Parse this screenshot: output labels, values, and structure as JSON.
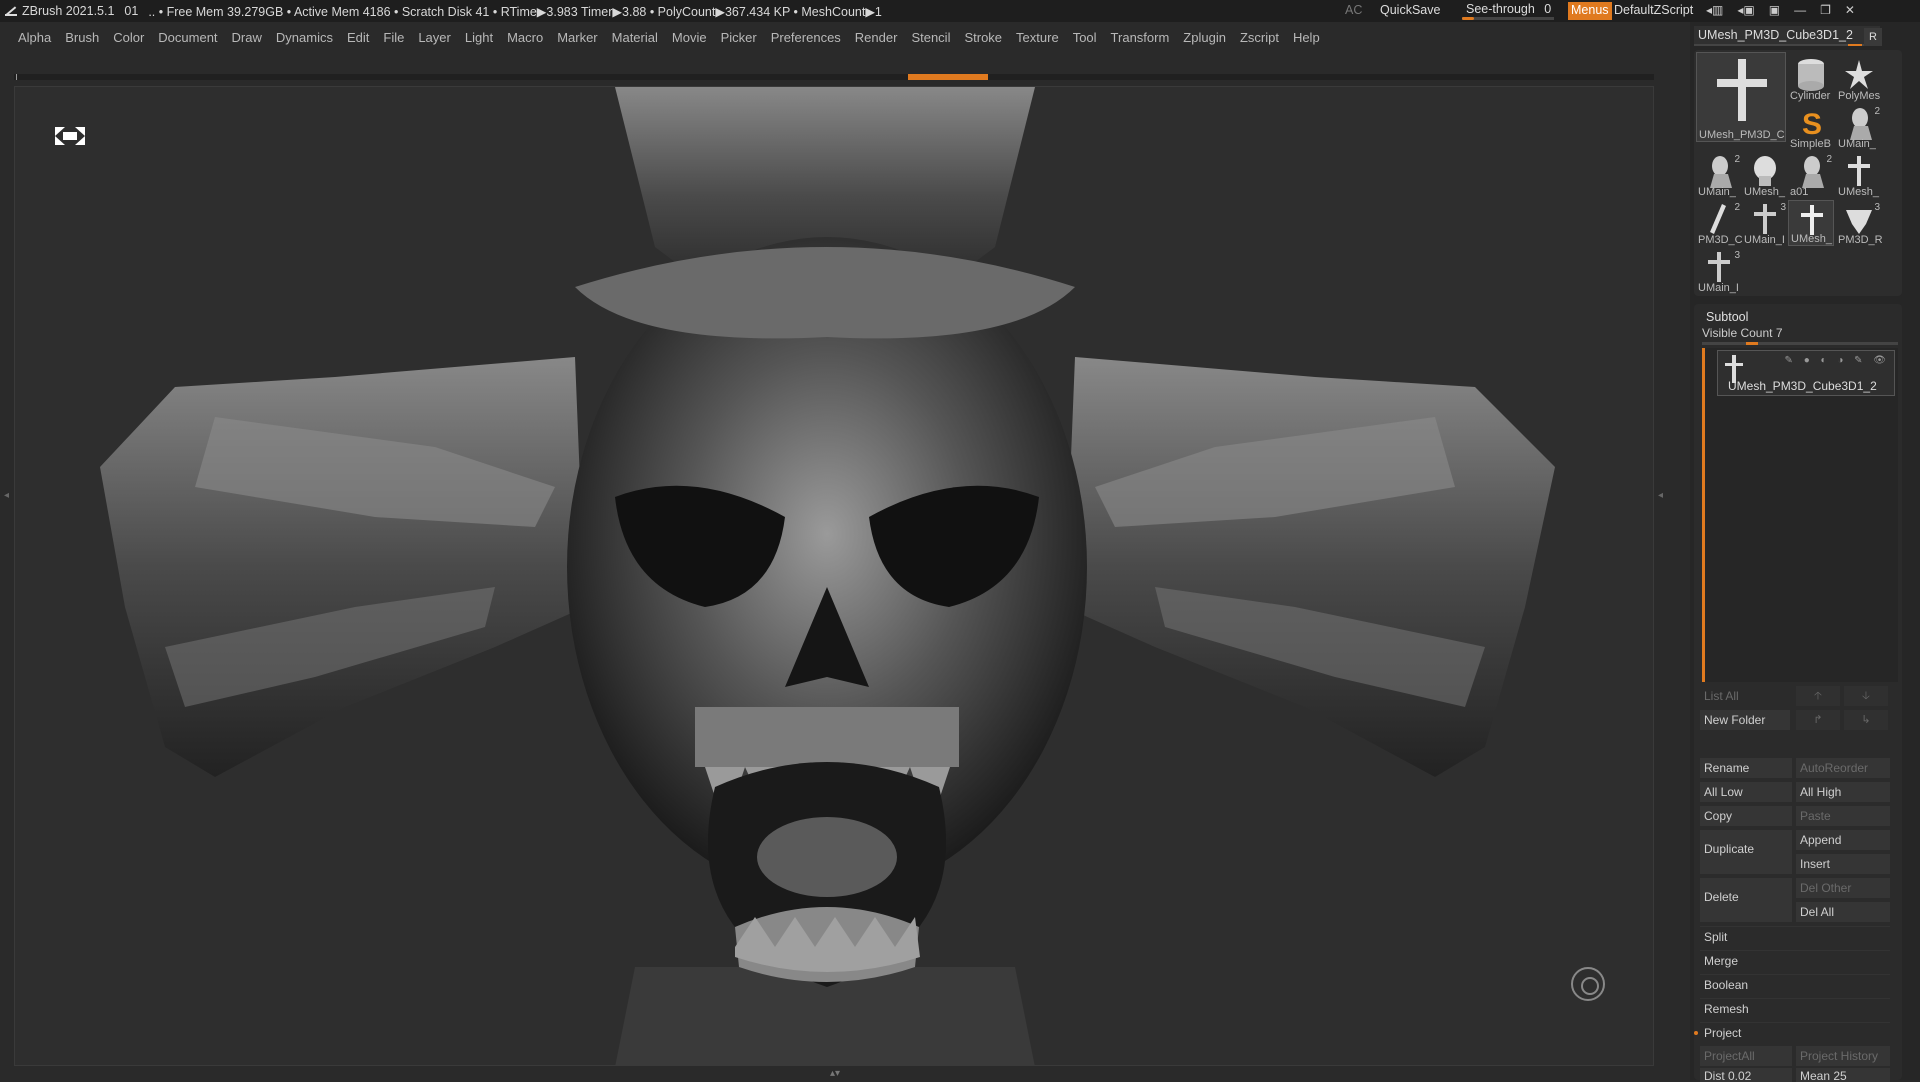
{
  "titlebar": {
    "app_title": "ZBrush 2021.5.1",
    "doc_index": "01",
    "stats": ".. • Free Mem 39.279GB • Active Mem 4186 • Scratch Disk 41 •  RTime▶3.983 Timer▶3.88 • PolyCount▶367.434 KP  • MeshCount▶1",
    "ac_label": "AC",
    "quicksave_label": "QuickSave",
    "seethrough_label": "See-through",
    "seethrough_value": "0",
    "menus_label": "Menus",
    "defaultzscript_label": "DefaultZScript"
  },
  "menubar": {
    "items": [
      "Alpha",
      "Brush",
      "Color",
      "Document",
      "Draw",
      "Dynamics",
      "Edit",
      "File",
      "Layer",
      "Light",
      "Macro",
      "Marker",
      "Material",
      "Movie",
      "Picker",
      "Preferences",
      "Render",
      "Stencil",
      "Stroke",
      "Texture",
      "Tool",
      "Transform",
      "Zplugin",
      "Zscript",
      "Help"
    ]
  },
  "tool_palette": {
    "current_tool": "UMesh_PM3D_Cube3D1_2",
    "r_label": "R",
    "thumbnails": [
      {
        "name": "UMesh_PM3D_C",
        "count": ""
      },
      {
        "name": "Cylinder",
        "count": ""
      },
      {
        "name": "PolyMes",
        "count": ""
      },
      {
        "name": "SimpleB",
        "count": ""
      },
      {
        "name": "UMain_",
        "count": "2"
      },
      {
        "name": "UMain_",
        "count": "2"
      },
      {
        "name": "UMesh_",
        "count": ""
      },
      {
        "name": "a01",
        "count": "2"
      },
      {
        "name": "UMesh_",
        "count": ""
      },
      {
        "name": "PM3D_C",
        "count": "2"
      },
      {
        "name": "UMain_I",
        "count": "3"
      },
      {
        "name": "UMesh_",
        "count": ""
      },
      {
        "name": "PM3D_R",
        "count": "3"
      },
      {
        "name": "UMain_I",
        "count": "3"
      }
    ]
  },
  "subtool": {
    "title": "Subtool",
    "visible_count_label": "Visible Count 7",
    "item_name": "UMesh_PM3D_Cube3D1_2",
    "list_all": "List All",
    "new_folder": "New Folder",
    "rename": "Rename",
    "auto_reorder": "AutoReorder",
    "all_low": "All Low",
    "all_high": "All High",
    "copy": "Copy",
    "paste": "Paste",
    "duplicate": "Duplicate",
    "append": "Append",
    "insert": "Insert",
    "delete": "Delete",
    "del_other": "Del Other",
    "del_all": "Del All",
    "split": "Split",
    "merge": "Merge",
    "boolean": "Boolean",
    "remesh": "Remesh",
    "project": "Project",
    "project_all": "ProjectAll",
    "project_history": "Project History",
    "dist": "Dist 0.02",
    "mean": "Mean 25"
  },
  "colors": {
    "accent": "#e07a1f",
    "background": "#2a2a2a",
    "panel": "#262626"
  },
  "icons": [
    "expand-icon",
    "navigation-gizmo-icon",
    "zbrush-logo-icon",
    "cylinder-icon",
    "polymesh-star-icon",
    "simplebrush-s-icon",
    "cross-mesh-icon"
  ]
}
